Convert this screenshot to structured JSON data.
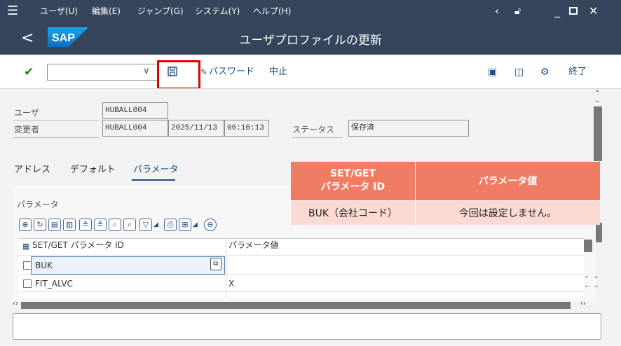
{
  "menu": {
    "items": [
      "ユーザ(U)",
      "編集(E)",
      "ジャンプ(G)",
      "システム(Y)",
      "ヘルプ(H)"
    ]
  },
  "header": {
    "back": "<",
    "logo": "SAP",
    "title": "ユーザプロファイルの更新"
  },
  "toolbar": {
    "command_value": "",
    "password": "パスワード",
    "cancel": "中止",
    "exit": "終了"
  },
  "fields": {
    "user_label": "ユーザ",
    "user_value": "HUBALL004",
    "changedby_label": "変更者",
    "changedby_value": "HUBALL004",
    "date_value": "2025/11/13",
    "time_value": "06:16:13",
    "status_label": "ステータス",
    "status_value": "保存済"
  },
  "tabs": {
    "address": "アドレス",
    "defaults": "デフォルト",
    "parameters": "パラメータ"
  },
  "params": {
    "section_label": "パラメータ",
    "col1": "SET/GET パラメータ ID",
    "col2": "パラメータ値",
    "rows": [
      {
        "id": "BUK",
        "value": ""
      },
      {
        "id": "FIT_ALVC",
        "value": "X"
      }
    ]
  },
  "overlay": {
    "header1_line1": "SET/GET",
    "header1_line2": "パラメータ ID",
    "header2": "パラメータ値",
    "cell1": "BUK（会社コード）",
    "cell2": "今回は設定しません。"
  },
  "colors": {
    "shell": "#35465c",
    "highlight": "#e00000",
    "overlay_header": "#f07d63",
    "overlay_cell": "#fbdad3"
  }
}
